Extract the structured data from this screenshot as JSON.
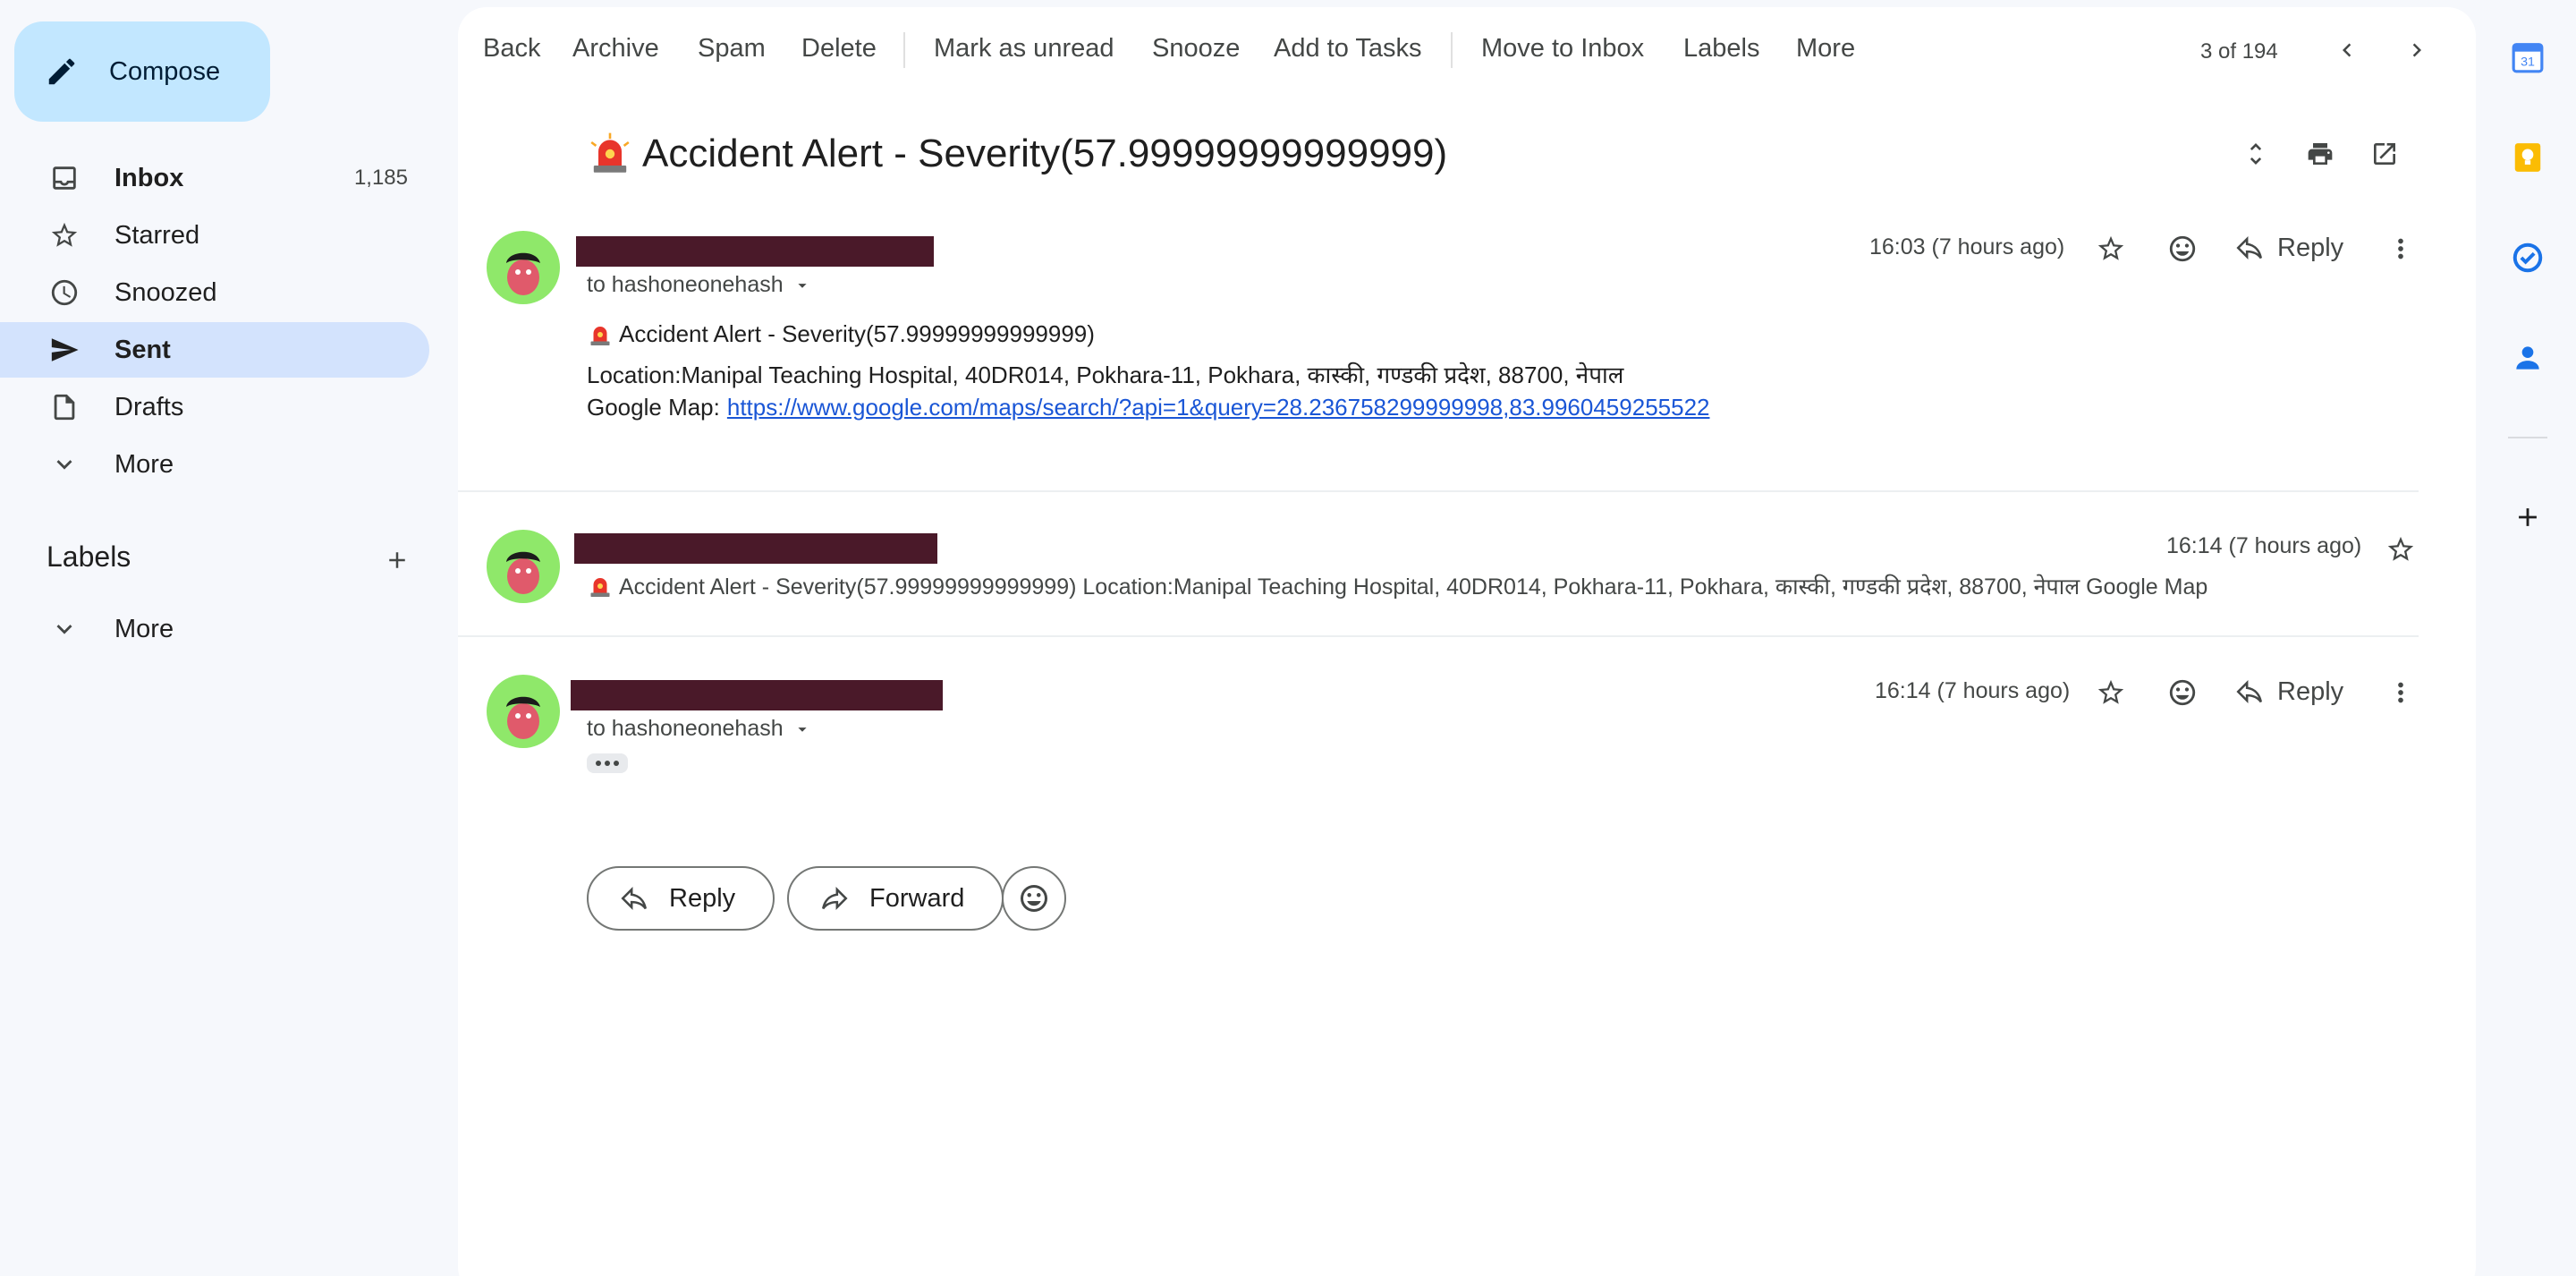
{
  "sidebar": {
    "compose_label": "Compose",
    "items": [
      {
        "label": "Inbox",
        "count": "1,185",
        "icon": "inbox-icon"
      },
      {
        "label": "Starred",
        "icon": "star-icon"
      },
      {
        "label": "Snoozed",
        "icon": "clock-icon"
      },
      {
        "label": "Sent",
        "icon": "send-icon"
      },
      {
        "label": "Drafts",
        "icon": "draft-icon"
      },
      {
        "label": "More",
        "icon": "chevron-down-icon"
      }
    ],
    "labels_heading": "Labels",
    "labels_more": "More"
  },
  "toolbar": {
    "back": "Back",
    "archive": "Archive",
    "spam": "Spam",
    "delete": "Delete",
    "mark_unread": "Mark as unread",
    "snooze": "Snooze",
    "add_tasks": "Add to Tasks",
    "move_inbox": "Move to Inbox",
    "labels": "Labels",
    "more": "More",
    "pager": "3 of 194"
  },
  "thread": {
    "subject": "Accident Alert - Severity(57.99999999999999)",
    "messages": [
      {
        "recipient": "to hashoneonehash",
        "timestamp": "16:03 (7 hours ago)",
        "reply_label": "Reply",
        "body": {
          "line1": "Accident Alert - Severity(57.99999999999999)",
          "line2": "Location:Manipal Teaching Hospital, 40DR014, Pokhara-11, Pokhara, कास्की, गण्डकी प्रदेश, 88700, नेपाल",
          "line3_prefix": "Google Map:",
          "link": "https://www.google.com/maps/search/?api=1&query=28.236758299999998,83.9960459255522"
        }
      },
      {
        "timestamp": "16:14 (7 hours ago)",
        "snippet": "Accident Alert - Severity(57.99999999999999) Location:Manipal Teaching Hospital, 40DR014, Pokhara-11, Pokhara, कास्की, गण्डकी प्रदेश, 88700, नेपाल Google Map"
      },
      {
        "recipient": "to hashoneonehash",
        "timestamp": "16:14 (7 hours ago)",
        "reply_label": "Reply"
      }
    ]
  },
  "actions": {
    "reply": "Reply",
    "forward": "Forward"
  },
  "colors": {
    "accent": "#0b57d0",
    "compose_bg": "#c2e7ff",
    "active_nav_bg": "#d3e3fd",
    "avatar_bg": "#8fe86a",
    "redaction": "#4a1929"
  }
}
